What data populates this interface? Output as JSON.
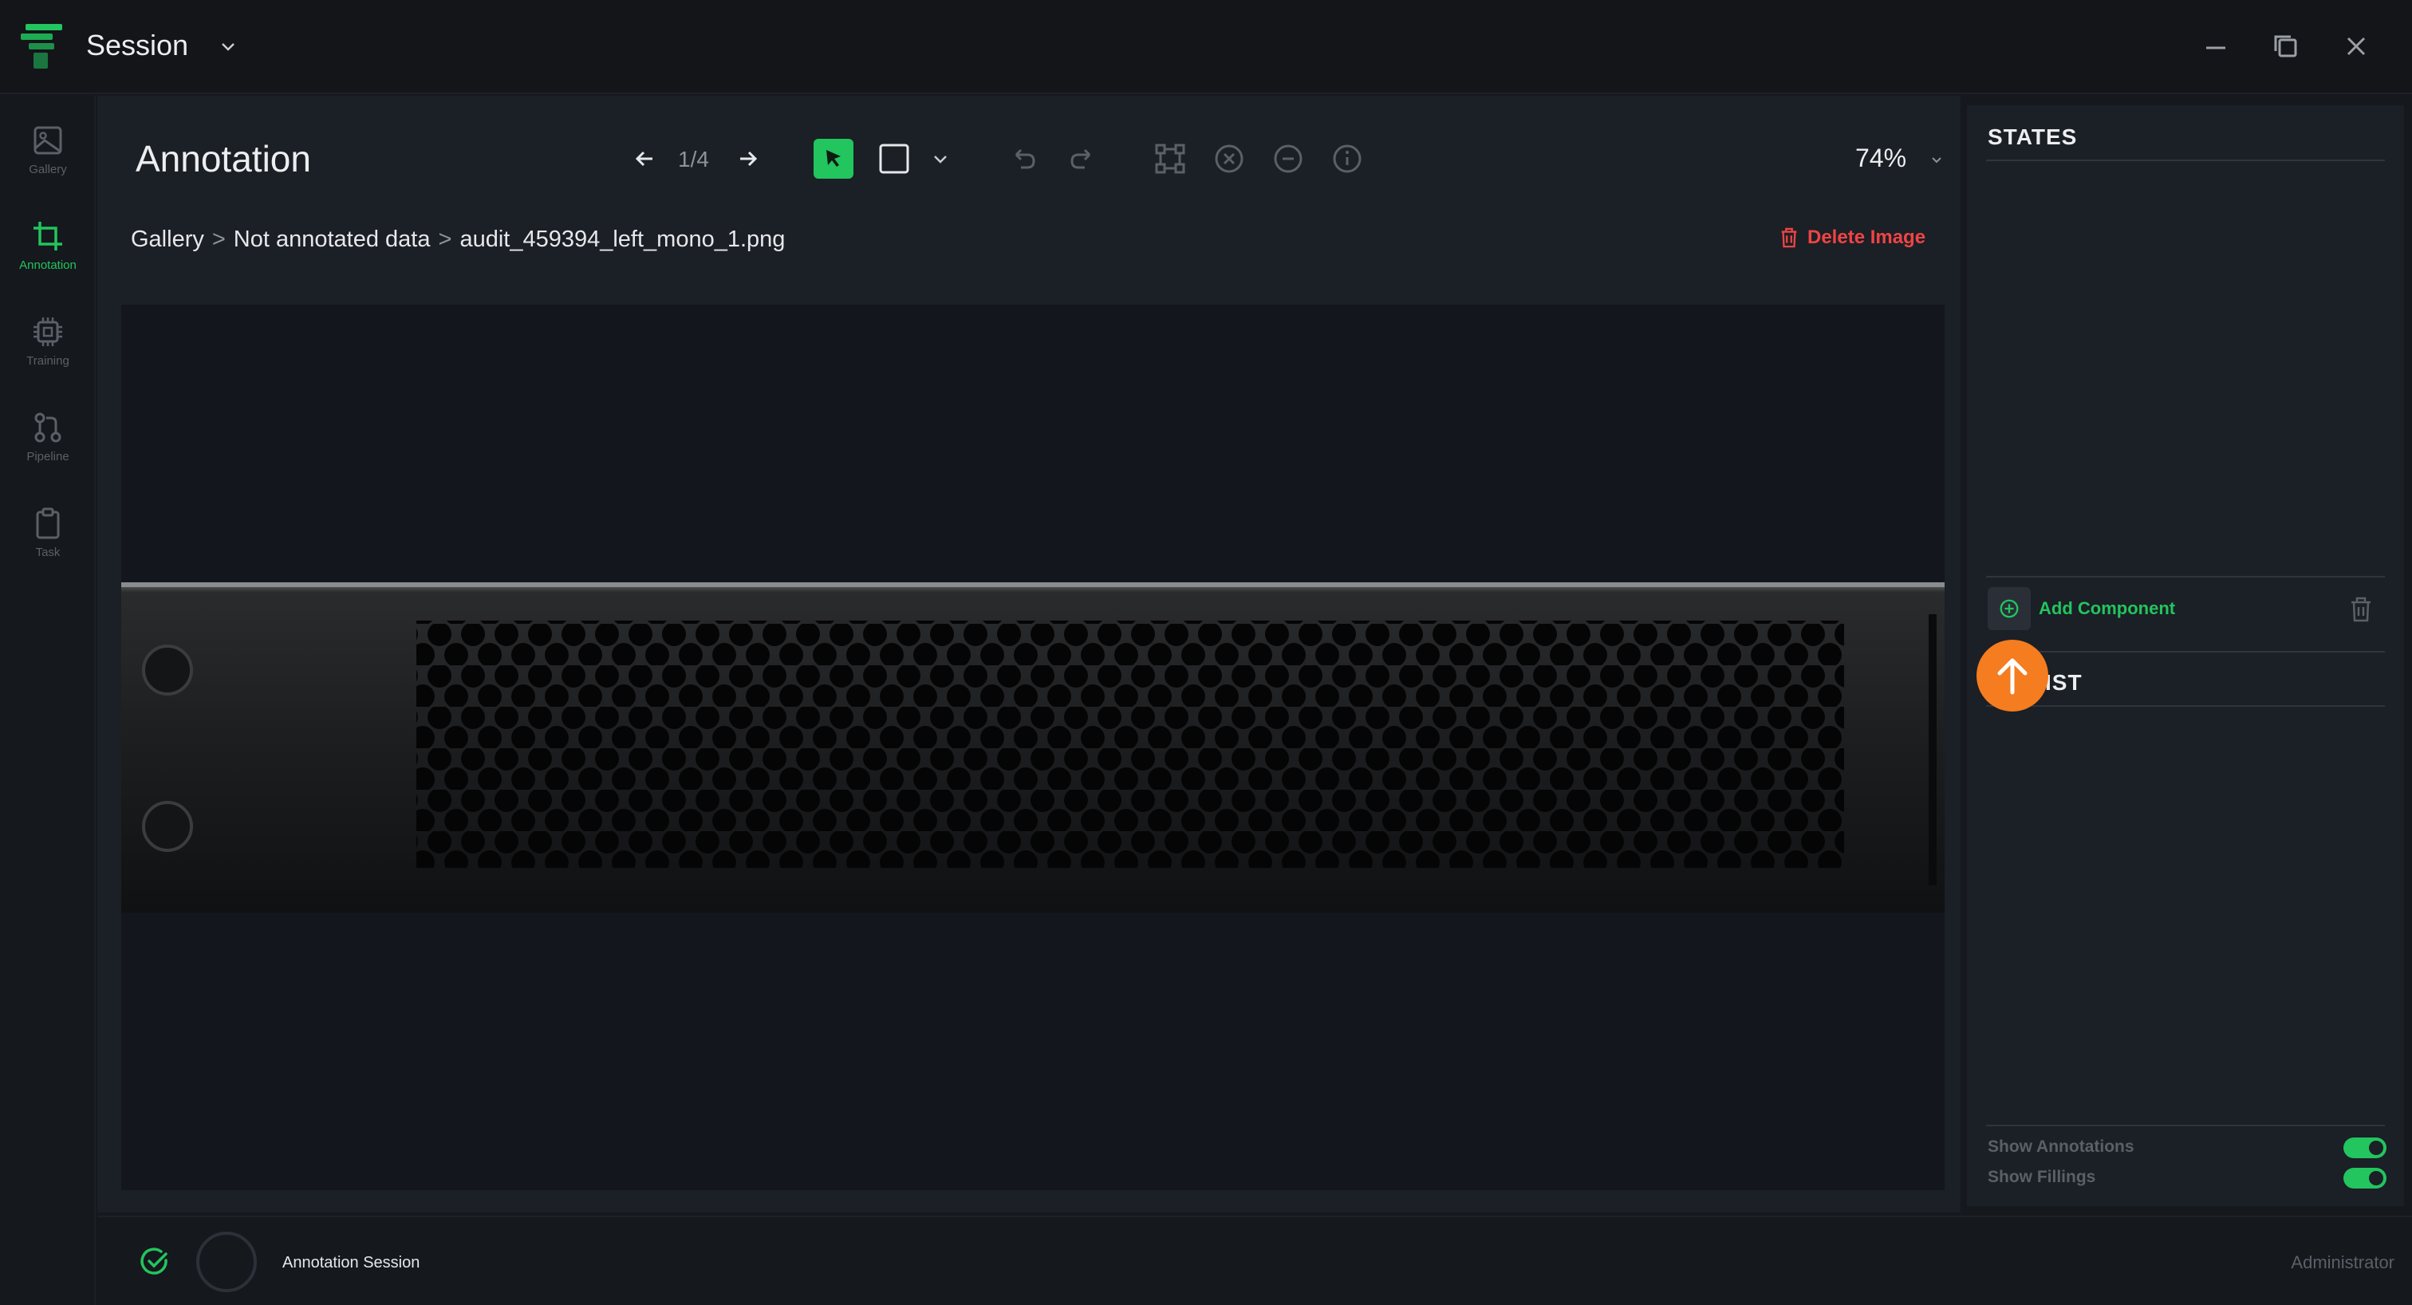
{
  "app": {
    "session_title": "Session",
    "colors": {
      "accent": "#22c55e",
      "danger": "#ef4444",
      "upload": "#f57c1f"
    }
  },
  "sidebar": {
    "items": [
      {
        "label": "Gallery",
        "icon": "image-icon"
      },
      {
        "label": "Annotation",
        "icon": "crop-icon",
        "active": true
      },
      {
        "label": "Training",
        "icon": "chip-icon"
      },
      {
        "label": "Pipeline",
        "icon": "git-pull-request-icon"
      },
      {
        "label": "Task",
        "icon": "clipboard-icon"
      }
    ]
  },
  "toolbar": {
    "title": "Annotation",
    "page_counter": "1/4",
    "zoom": "74%"
  },
  "breadcrumb": {
    "items": [
      "Gallery",
      "Not annotated data",
      "audit_459394_left_mono_1.png"
    ],
    "separator": ">"
  },
  "actions": {
    "delete_image": "Delete Image"
  },
  "panel": {
    "states_title": "STATES",
    "add_component": "Add Component",
    "list_title": "IST",
    "show_annotations": "Show Annotations",
    "show_fillings": "Show Fillings"
  },
  "statusbar": {
    "session_label": "Annotation Session",
    "user": "Administrator"
  }
}
